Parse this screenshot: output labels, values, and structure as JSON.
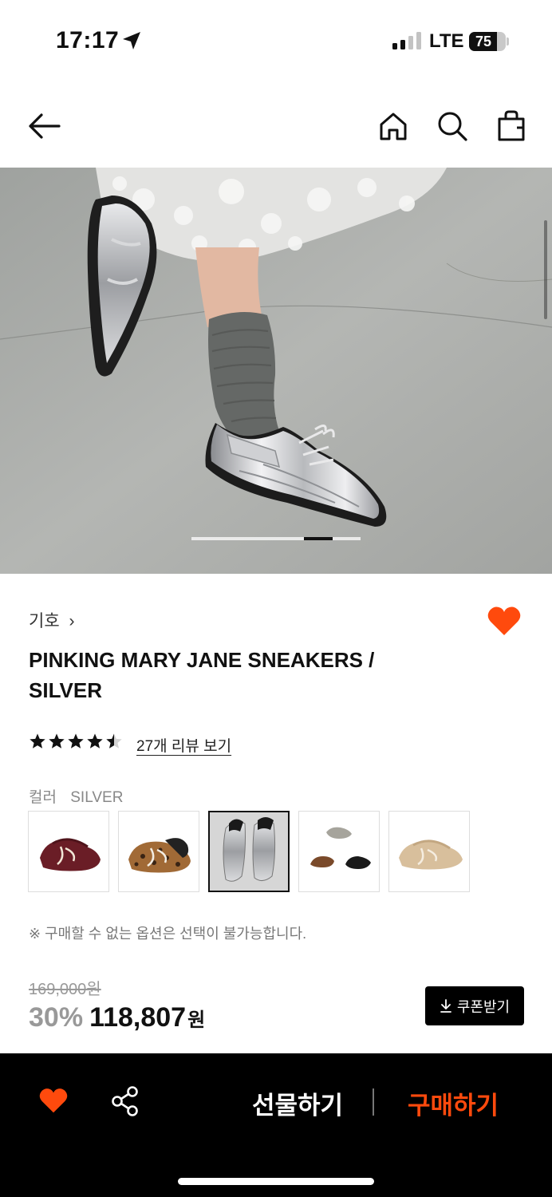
{
  "status_bar": {
    "time": "17:17",
    "network": "LTE",
    "battery_percent": "75",
    "battery_level": 0.75
  },
  "nav": {
    "back_icon": "arrow-left-icon",
    "home_icon": "home-icon",
    "search_icon": "search-icon",
    "bag_icon": "shopping-bag-icon"
  },
  "gallery": {
    "slide_index": 5,
    "slide_count": 6
  },
  "product": {
    "brand": "기호",
    "brand_chevron": "›",
    "title": "PINKING MARY JANE SNEAKERS / SILVER",
    "rating": 4.5,
    "review_link": "27개 리뷰 보기",
    "liked": true,
    "color_label": "컬러",
    "color_value": "SILVER",
    "swatches": [
      {
        "name": "burgundy",
        "selected": false
      },
      {
        "name": "leopard",
        "selected": false
      },
      {
        "name": "silver",
        "selected": true
      },
      {
        "name": "multi",
        "selected": false
      },
      {
        "name": "beige",
        "selected": false
      }
    ],
    "notice": "※ 구매할 수 없는 옵션은 선택이 불가능합니다.",
    "original_price": "169,000원",
    "discount": "30%",
    "price": "118,807",
    "currency": "원",
    "coupon_button": "쿠폰받기"
  },
  "bottom_bar": {
    "gift_label": "선물하기",
    "buy_label": "구매하기",
    "accent_color": "#ff4a0d"
  }
}
